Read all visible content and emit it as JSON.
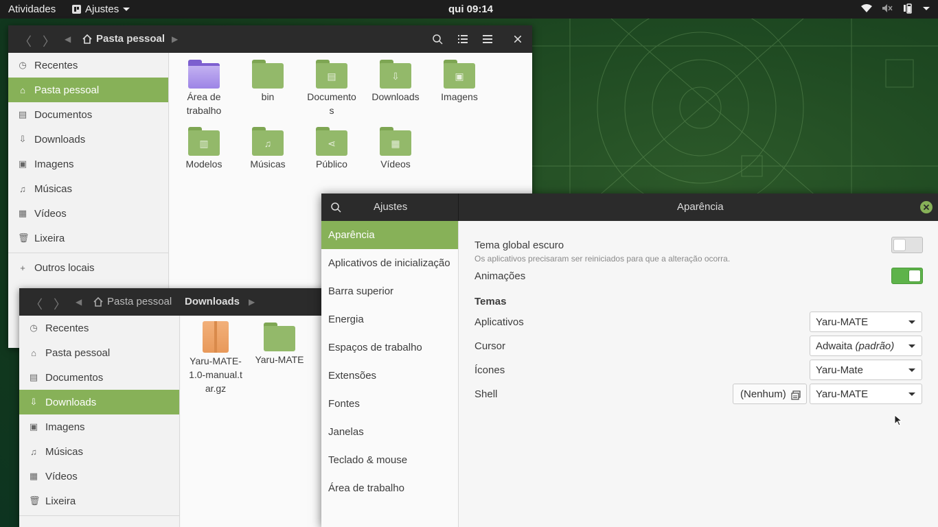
{
  "topbar": {
    "activities": "Atividades",
    "app_menu": "Ajustes",
    "clock": "qui 09:14"
  },
  "fm1": {
    "breadcrumb_home": "Pasta pessoal",
    "sidebar": [
      {
        "label": "Recentes",
        "icon": "clock-icon"
      },
      {
        "label": "Pasta pessoal",
        "icon": "home-icon"
      },
      {
        "label": "Documentos",
        "icon": "document-icon"
      },
      {
        "label": "Downloads",
        "icon": "download-icon"
      },
      {
        "label": "Imagens",
        "icon": "image-icon"
      },
      {
        "label": "Músicas",
        "icon": "music-icon"
      },
      {
        "label": "Vídeos",
        "icon": "video-icon"
      },
      {
        "label": "Lixeira",
        "icon": "trash-icon"
      },
      {
        "label": "Outros locais",
        "icon": "plus-icon"
      }
    ],
    "files": [
      {
        "name": "Área de trabalho"
      },
      {
        "name": "bin"
      },
      {
        "name": "Documentos"
      },
      {
        "name": "Downloads"
      },
      {
        "name": "Imagens"
      },
      {
        "name": "Modelos"
      },
      {
        "name": "Músicas"
      },
      {
        "name": "Público"
      },
      {
        "name": "Vídeos"
      }
    ]
  },
  "fm2": {
    "breadcrumb_home": "Pasta pessoal",
    "breadcrumb_current": "Downloads",
    "sidebar": [
      {
        "label": "Recentes"
      },
      {
        "label": "Pasta pessoal"
      },
      {
        "label": "Documentos"
      },
      {
        "label": "Downloads"
      },
      {
        "label": "Imagens"
      },
      {
        "label": "Músicas"
      },
      {
        "label": "Vídeos"
      },
      {
        "label": "Lixeira"
      }
    ],
    "files": [
      {
        "name": "Yaru-MATE-1.0-manual.tar.gz"
      },
      {
        "name": "Yaru-MATE"
      }
    ]
  },
  "tweaks": {
    "sidebar_title": "Ajustes",
    "page_title": "Aparência",
    "nav": [
      "Aparência",
      "Aplicativos de inicialização",
      "Barra superior",
      "Energia",
      "Espaços de trabalho",
      "Extensões",
      "Fontes",
      "Janelas",
      "Teclado & mouse",
      "Área de trabalho"
    ],
    "dark_theme": {
      "label": "Tema global escuro",
      "note": "Os aplicativos precisaram ser reiniciados para que a alteração ocorra.",
      "on": false
    },
    "animations": {
      "label": "Animações",
      "on": true
    },
    "themes_header": "Temas",
    "applications": {
      "label": "Aplicativos",
      "value": "Yaru-MATE"
    },
    "cursor": {
      "label": "Cursor",
      "value": "Adwaita",
      "suffix": "(padrão)"
    },
    "icons": {
      "label": "Ícones",
      "value": "Yaru-Mate"
    },
    "shell": {
      "label": "Shell",
      "file_button": "(Nenhum)",
      "value": "Yaru-MATE"
    },
    "accent_color": "#87b158",
    "switch_on_color": "#5eb34a"
  }
}
